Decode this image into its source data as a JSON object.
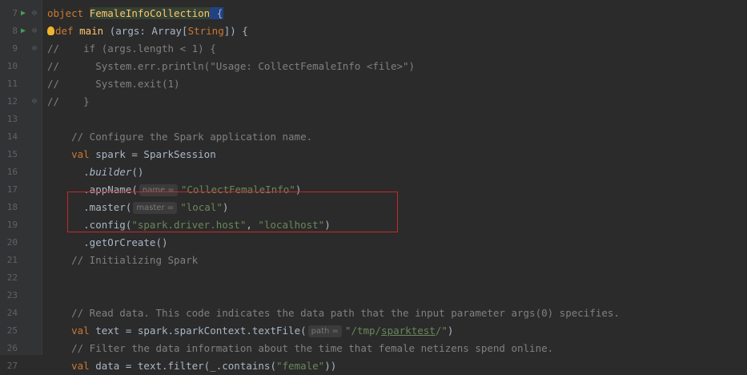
{
  "lines": [
    {
      "n": "7",
      "parts": [
        {
          "t": "object ",
          "c": "kw"
        },
        {
          "t": "FemaleInfoCollection",
          "c": "fn obj-name"
        },
        {
          "t": " {",
          "c": "cursor-box"
        }
      ]
    },
    {
      "n": "8",
      "parts": [
        {
          "t": "def ",
          "c": "kw"
        },
        {
          "t": "main",
          "c": "fn"
        },
        {
          "t": " (args: Array[",
          "c": ""
        },
        {
          "t": "String",
          "c": "kw"
        },
        {
          "t": "]) {",
          "c": ""
        }
      ]
    },
    {
      "n": "9",
      "parts": [
        {
          "t": "//    if (args.length < 1) {",
          "c": "cmt"
        }
      ]
    },
    {
      "n": "10",
      "parts": [
        {
          "t": "//      System.err.println(\"Usage: CollectFemaleInfo <file>\")",
          "c": "cmt"
        }
      ]
    },
    {
      "n": "11",
      "parts": [
        {
          "t": "//      System.exit(1)",
          "c": "cmt"
        }
      ]
    },
    {
      "n": "12",
      "parts": [
        {
          "t": "//    }",
          "c": "cmt"
        }
      ]
    },
    {
      "n": "13",
      "parts": []
    },
    {
      "n": "14",
      "parts": [
        {
          "t": "    // Configure the Spark application name.",
          "c": "cmt"
        }
      ]
    },
    {
      "n": "15",
      "parts": [
        {
          "t": "    val ",
          "c": "kw"
        },
        {
          "t": "spark = SparkSession",
          "c": ""
        }
      ]
    },
    {
      "n": "16",
      "parts": [
        {
          "t": "      .",
          "c": ""
        },
        {
          "t": "builder",
          "c": "it"
        },
        {
          "t": "()",
          "c": ""
        }
      ]
    },
    {
      "n": "17",
      "parts": [
        {
          "t": "      .appName(",
          "c": ""
        },
        {
          "t": "name =",
          "c": "hint"
        },
        {
          "t": "\"CollectFemaleInfo\"",
          "c": "str"
        },
        {
          "t": ")",
          "c": ""
        }
      ]
    },
    {
      "n": "18",
      "parts": [
        {
          "t": "      .master(",
          "c": ""
        },
        {
          "t": "master =",
          "c": "hint"
        },
        {
          "t": "\"local\"",
          "c": "str"
        },
        {
          "t": ")",
          "c": ""
        }
      ]
    },
    {
      "n": "19",
      "parts": [
        {
          "t": "      .config(",
          "c": ""
        },
        {
          "t": "\"spark.driver.host\"",
          "c": "str"
        },
        {
          "t": ", ",
          "c": ""
        },
        {
          "t": "\"localhost\"",
          "c": "str"
        },
        {
          "t": ")",
          "c": ""
        }
      ]
    },
    {
      "n": "20",
      "parts": [
        {
          "t": "      .getOrCreate()",
          "c": ""
        }
      ]
    },
    {
      "n": "21",
      "parts": [
        {
          "t": "    // Initializing Spark",
          "c": "cmt"
        }
      ]
    },
    {
      "n": "22",
      "parts": []
    },
    {
      "n": "23",
      "parts": []
    },
    {
      "n": "24",
      "parts": [
        {
          "t": "    // Read data. This code indicates the data path that the input parameter args(0) specifies.",
          "c": "cmt"
        }
      ]
    },
    {
      "n": "25",
      "parts": [
        {
          "t": "    val ",
          "c": "kw"
        },
        {
          "t": "text = spark.sparkContext.textFile(",
          "c": ""
        },
        {
          "t": "path =",
          "c": "hint"
        },
        {
          "t": "\"/tmp/",
          "c": "str"
        },
        {
          "t": "sparktest",
          "c": "str-link"
        },
        {
          "t": "/\"",
          "c": "str"
        },
        {
          "t": ")",
          "c": ""
        }
      ]
    },
    {
      "n": "26",
      "parts": [
        {
          "t": "    // Filter the data information about the time that female netizens spend online.",
          "c": "cmt"
        }
      ]
    },
    {
      "n": "27",
      "parts": [
        {
          "t": "    val ",
          "c": "kw"
        },
        {
          "t": "data = text.filter(_.contains(",
          "c": ""
        },
        {
          "t": "\"female\"",
          "c": "str"
        },
        {
          "t": "))",
          "c": ""
        }
      ]
    }
  ],
  "gutter_marks": {
    "run": {
      "7": "▶",
      "8": "▶"
    },
    "fold": {
      "7": "⊖",
      "8": "⊖",
      "9": "⊖",
      "12": "⊖"
    }
  },
  "colors": {
    "background": "#2b2b2b",
    "keyword": "#cc7832",
    "function": "#ffc66d",
    "string": "#6a8759",
    "comment": "#808080",
    "highlight_border": "#c62828"
  },
  "icons": {
    "run": "run-gutter-icon",
    "fold": "fold-marker-icon",
    "intention": "lightbulb-icon"
  }
}
